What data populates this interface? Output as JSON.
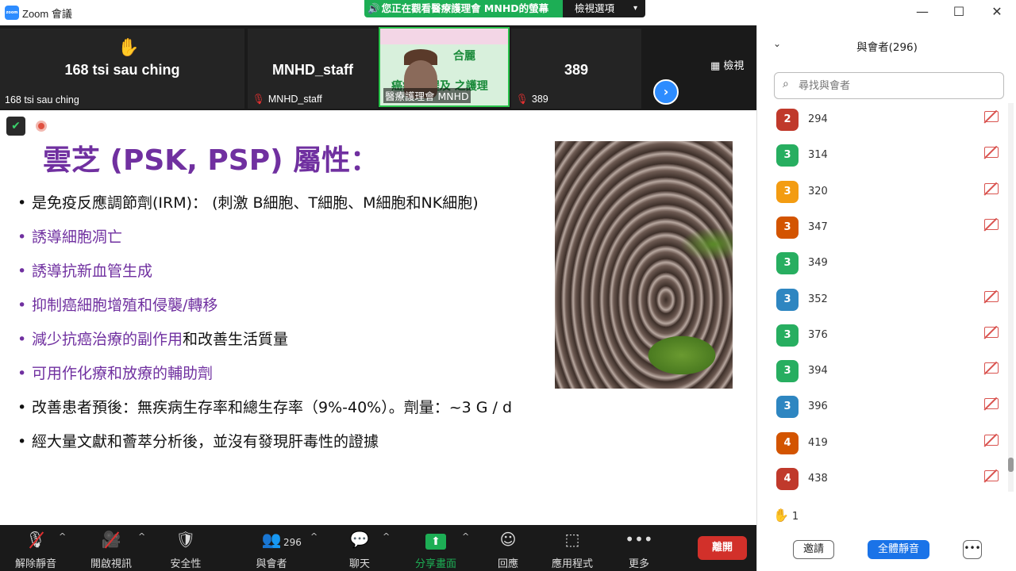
{
  "window": {
    "title": "Zoom 會議",
    "logo_text": "zoom",
    "share_banner": "您正在觀看醫療護理會 MNHD的螢幕",
    "view_options": "檢視選項",
    "minimize": "—",
    "maximize": "☐",
    "close": "✕"
  },
  "strip": {
    "view_label": "檢視",
    "tiles": [
      {
        "big": "168 tsi sau ching",
        "small": "168 tsi sau ching",
        "muted": false
      },
      {
        "big": "MNHD_staff",
        "small": "MNHD_staff",
        "muted": true
      },
      {
        "big": "389",
        "small": "389",
        "muted": true
      }
    ],
    "active_tile": {
      "label": "醫療護理會 MNHD",
      "title1": "合麗",
      "title2": "癌症 療程及 之護理"
    }
  },
  "slide": {
    "title": "雲芝 (PSK, PSP) 屬性：",
    "bullets": [
      {
        "parts": [
          {
            "text": "是免疫反應調節劑(IRM)： (刺激 B細胞、T細胞、M細胞和NK細胞)",
            "color": "black"
          }
        ],
        "bullet_color": "black"
      },
      {
        "parts": [
          {
            "text": "誘導細胞凋亡",
            "color": "purple"
          }
        ],
        "bullet_color": "purple"
      },
      {
        "parts": [
          {
            "text": "誘導抗新血管生成",
            "color": "purple"
          }
        ],
        "bullet_color": "purple"
      },
      {
        "parts": [
          {
            "text": "抑制癌細胞增殖和侵襲/轉移",
            "color": "purple"
          }
        ],
        "bullet_color": "purple"
      },
      {
        "parts": [
          {
            "text": "減少抗癌治療的副作用",
            "color": "purple"
          },
          {
            "text": "和改善生活質量",
            "color": "black"
          }
        ],
        "bullet_color": "purple"
      },
      {
        "parts": [
          {
            "text": "可用作化療和放療的輔助劑",
            "color": "purple"
          }
        ],
        "bullet_color": "purple"
      },
      {
        "parts": [
          {
            "text": "改善患者預後：無疾病生存率和總生存率（9%-40%）。劑量：~3 G / d",
            "color": "black"
          }
        ],
        "bullet_color": "black"
      },
      {
        "parts": [
          {
            "text": "經大量文獻和薈萃分析後，並沒有發現肝毒性的證據",
            "color": "black"
          }
        ],
        "bullet_color": "black"
      }
    ]
  },
  "toolbar": {
    "mute": "解除靜音",
    "video": "開啟視訊",
    "security": "安全性",
    "participants": "與會者",
    "participants_count": "296",
    "chat": "聊天",
    "share": "分享畫面",
    "reactions": "回應",
    "apps": "應用程式",
    "more": "更多",
    "leave": "離開"
  },
  "panel": {
    "title": "與會者(296)",
    "search_placeholder": "尋找與會者",
    "raised_hands": "1",
    "invite": "邀請",
    "mute_all": "全體靜音",
    "more": "•••",
    "participants": [
      {
        "initial": "2",
        "name": "294",
        "color": "#c0392b",
        "cam_off": true
      },
      {
        "initial": "3",
        "name": "314",
        "color": "#27ae60",
        "cam_off": true
      },
      {
        "initial": "3",
        "name": "320",
        "color": "#f39c12",
        "cam_off": true
      },
      {
        "initial": "3",
        "name": "347",
        "color": "#d35400",
        "cam_off": true
      },
      {
        "initial": "3",
        "name": "349",
        "color": "#27ae60",
        "cam_off": false
      },
      {
        "initial": "3",
        "name": "352",
        "color": "#2e86c1",
        "cam_off": true
      },
      {
        "initial": "3",
        "name": "376",
        "color": "#27ae60",
        "cam_off": true
      },
      {
        "initial": "3",
        "name": "394",
        "color": "#27ae60",
        "cam_off": true
      },
      {
        "initial": "3",
        "name": "396",
        "color": "#2e86c1",
        "cam_off": true
      },
      {
        "initial": "4",
        "name": "419",
        "color": "#d35400",
        "cam_off": true
      },
      {
        "initial": "4",
        "name": "438",
        "color": "#c0392b",
        "cam_off": true
      }
    ]
  }
}
